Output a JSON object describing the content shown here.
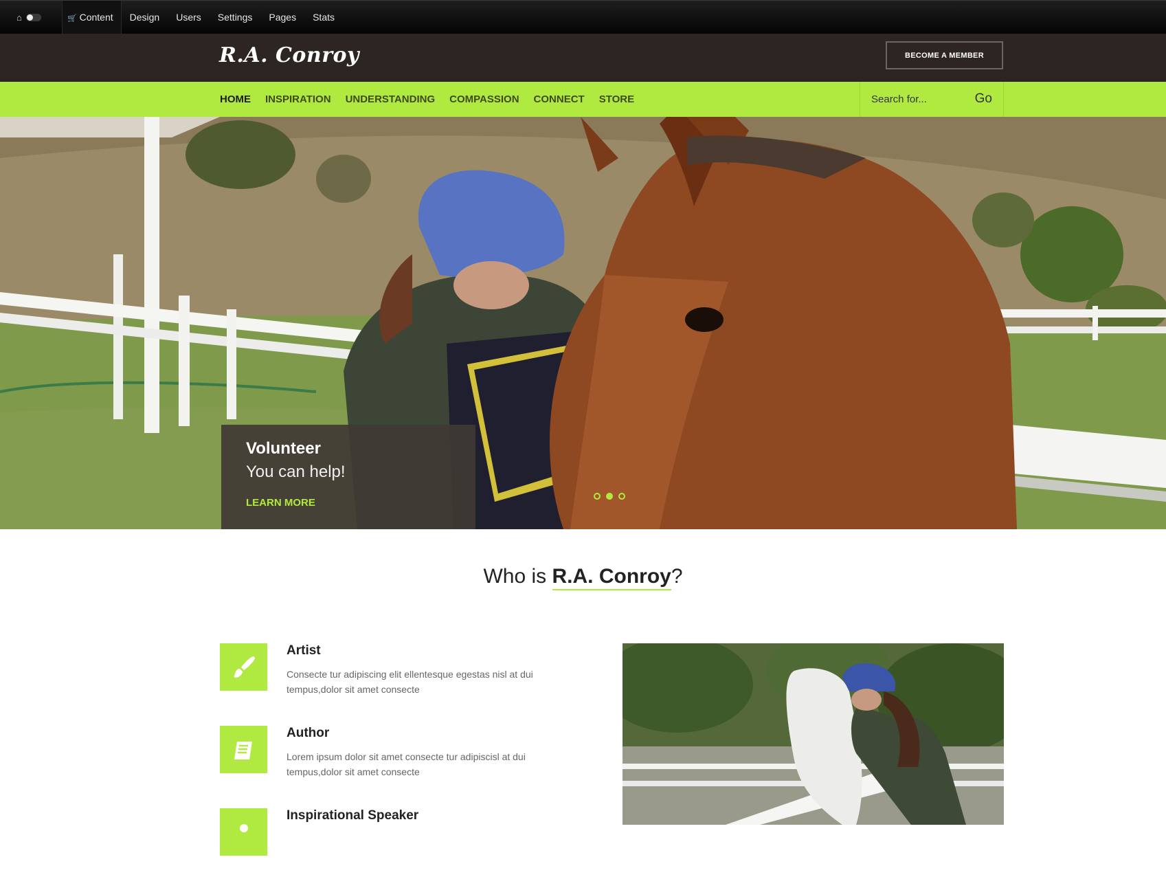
{
  "admin_bar": {
    "home_icon": "home-icon",
    "cart_icon": "cart-icon",
    "items": [
      {
        "label": "Content"
      },
      {
        "label": "Design"
      },
      {
        "label": "Users"
      },
      {
        "label": "Settings"
      },
      {
        "label": "Pages"
      },
      {
        "label": "Stats"
      }
    ]
  },
  "header": {
    "logo": "R.A. Conroy",
    "member_button": "BECOME A MEMBER"
  },
  "nav": {
    "items": [
      {
        "label": "HOME"
      },
      {
        "label": "INSPIRATION"
      },
      {
        "label": "UNDERSTANDING"
      },
      {
        "label": "COMPASSION"
      },
      {
        "label": "CONNECT"
      },
      {
        "label": "STORE"
      }
    ],
    "search_placeholder": "Search for...",
    "search_button": "Go"
  },
  "hero": {
    "caption_title": "Volunteer",
    "caption_subtitle": "You can help!",
    "caption_link": "LEARN MORE",
    "slide_count": 3,
    "active_slide": 2
  },
  "who": {
    "prefix": "Who is ",
    "name": "R.A. Conroy",
    "suffix": "?"
  },
  "features": [
    {
      "title": "Artist",
      "text": "Consecte tur adipiscing elit ellentesque egestas nisl at dui tempus,dolor sit amet consecte",
      "icon": "paintbrush-icon"
    },
    {
      "title": "Author",
      "text": "Lorem ipsum dolor sit amet consecte tur adipiscisl at dui tempus,dolor sit amet consecte",
      "icon": "book-icon"
    },
    {
      "title": "Inspirational Speaker",
      "text": "",
      "icon": "speaker-icon"
    }
  ],
  "colors": {
    "accent": "#b0e940",
    "header_bg": "#2c2522",
    "admin_bg": "#0a0a0a",
    "caption_bg": "#403a34"
  }
}
